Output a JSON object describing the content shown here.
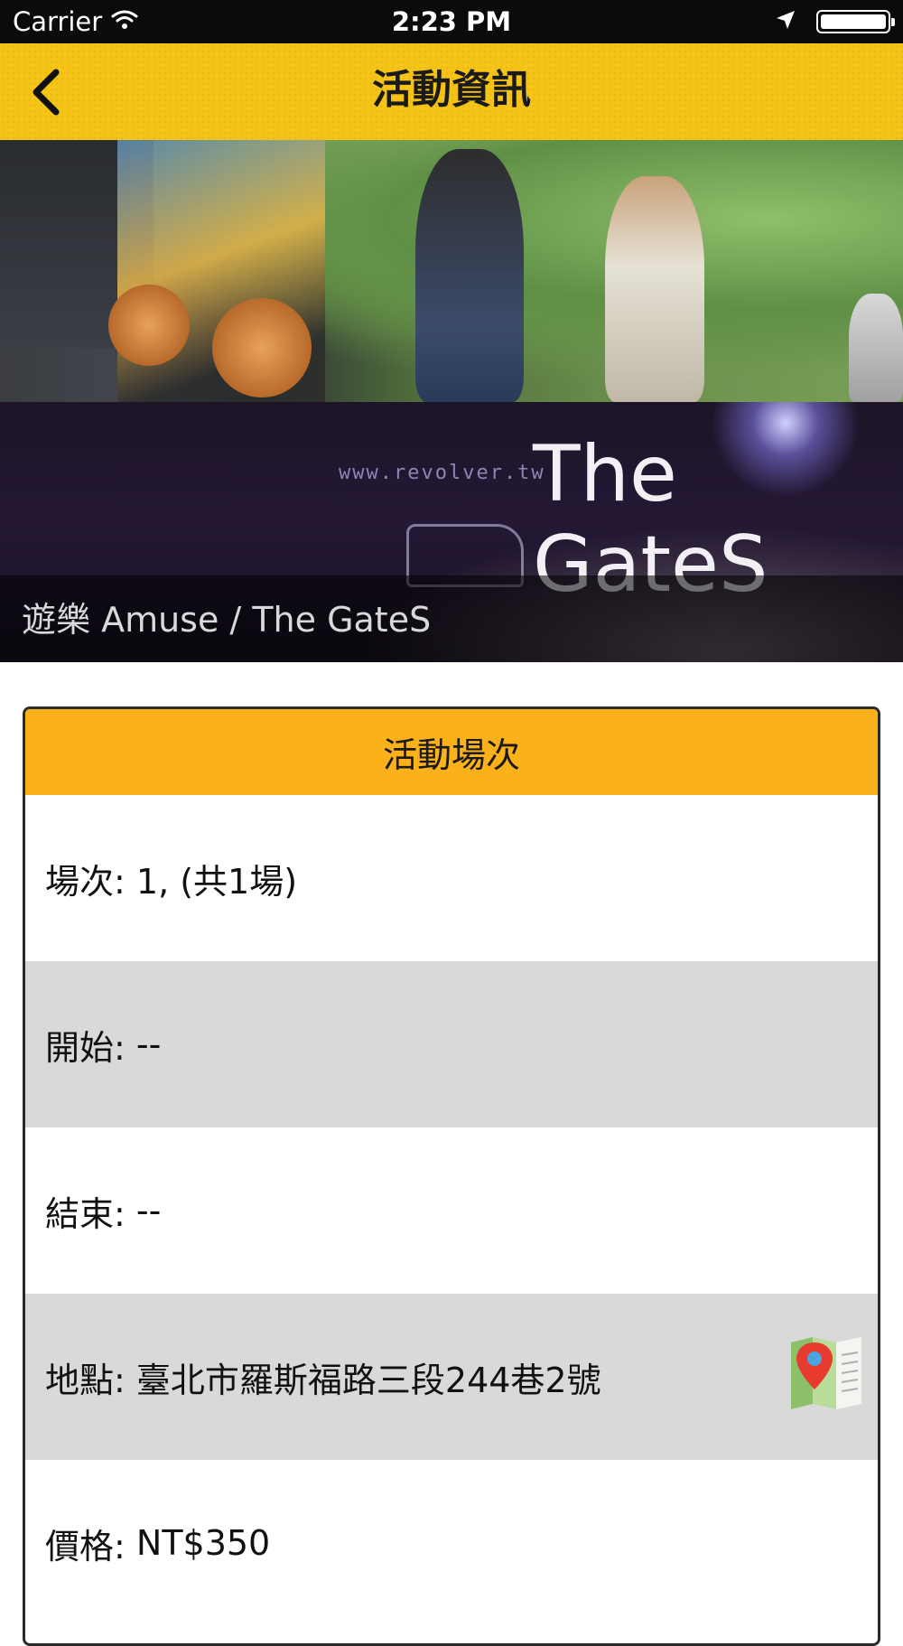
{
  "status_bar": {
    "carrier": "Carrier",
    "time": "2:23 PM"
  },
  "nav": {
    "title": "活動資訊",
    "back_icon": "chevron-left-icon"
  },
  "hero": {
    "band_name": "The GateS",
    "url_text": "www.revolver.tw",
    "caption": "遊樂 Amuse / The GateS"
  },
  "card": {
    "header": "活動場次",
    "rows": [
      {
        "label": "場次: ",
        "value": "1, (共1場)"
      },
      {
        "label": "開始: ",
        "value": "--"
      },
      {
        "label": "結束: ",
        "value": "--"
      },
      {
        "label": "地點: ",
        "value": "臺北市羅斯福路三段244巷2號"
      },
      {
        "label": "價格: ",
        "value": "NT$350"
      }
    ],
    "map_icon": "map-pin-icon"
  },
  "colors": {
    "nav_yellow": "#f6c417",
    "card_header": "#fbb119",
    "row_alt": "#d9d9d9"
  }
}
